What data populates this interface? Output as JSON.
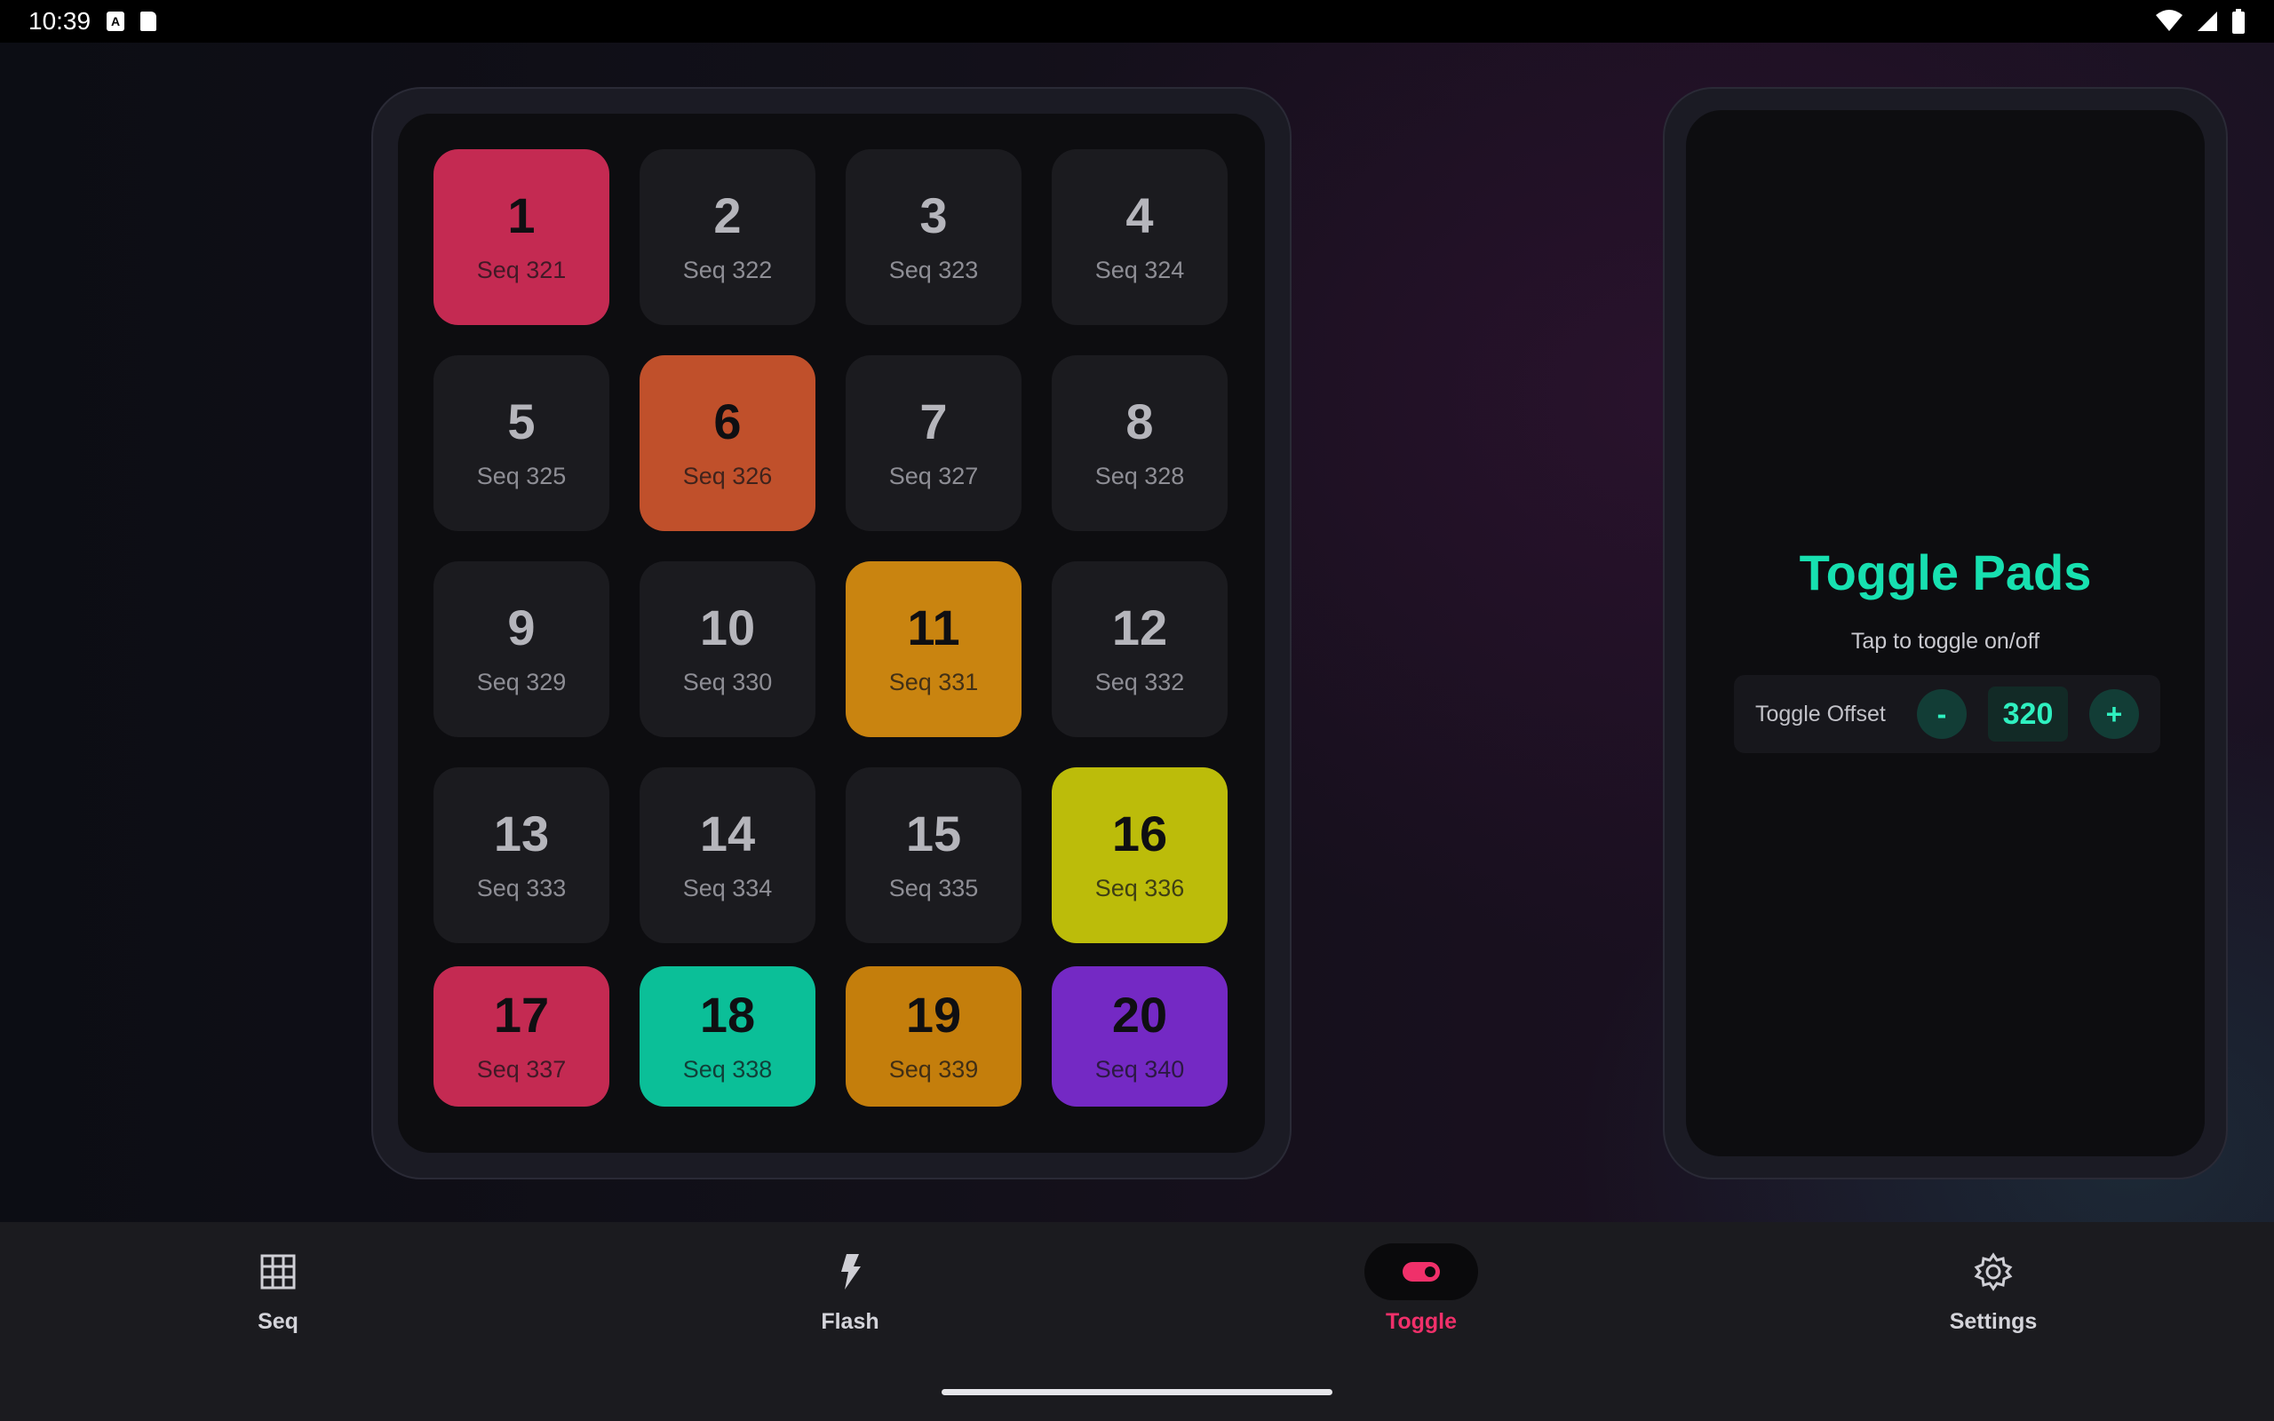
{
  "status_bar": {
    "time": "10:39"
  },
  "pads": [
    {
      "num": "1",
      "seq": "Seq 321",
      "on": true,
      "color": "#c42a52"
    },
    {
      "num": "2",
      "seq": "Seq 322",
      "on": false
    },
    {
      "num": "3",
      "seq": "Seq 323",
      "on": false
    },
    {
      "num": "4",
      "seq": "Seq 324",
      "on": false
    },
    {
      "num": "5",
      "seq": "Seq 325",
      "on": false
    },
    {
      "num": "6",
      "seq": "Seq 326",
      "on": true,
      "color": "#c0502b"
    },
    {
      "num": "7",
      "seq": "Seq 327",
      "on": false
    },
    {
      "num": "8",
      "seq": "Seq 328",
      "on": false
    },
    {
      "num": "9",
      "seq": "Seq 329",
      "on": false
    },
    {
      "num": "10",
      "seq": "Seq 330",
      "on": false
    },
    {
      "num": "11",
      "seq": "Seq 331",
      "on": true,
      "color": "#c98410"
    },
    {
      "num": "12",
      "seq": "Seq 332",
      "on": false
    },
    {
      "num": "13",
      "seq": "Seq 333",
      "on": false
    },
    {
      "num": "14",
      "seq": "Seq 334",
      "on": false
    },
    {
      "num": "15",
      "seq": "Seq 335",
      "on": false
    },
    {
      "num": "16",
      "seq": "Seq 336",
      "on": true,
      "color": "#bcbc0a"
    },
    {
      "num": "17",
      "seq": "Seq 337",
      "on": true,
      "color": "#c42a52"
    },
    {
      "num": "18",
      "seq": "Seq 338",
      "on": true,
      "color": "#0bbf98"
    },
    {
      "num": "19",
      "seq": "Seq 339",
      "on": true,
      "color": "#c47e0c"
    },
    {
      "num": "20",
      "seq": "Seq 340",
      "on": true,
      "color": "#7429c4"
    }
  ],
  "toggle_panel": {
    "title": "Toggle Pads",
    "subtitle": "Tap to toggle on/off",
    "offset_label": "Toggle Offset",
    "minus_label": "-",
    "offset_value": "320",
    "plus_label": "+"
  },
  "nav": [
    {
      "label": "Seq",
      "icon": "grid-icon",
      "active": false
    },
    {
      "label": "Flash",
      "icon": "flash-icon",
      "active": false
    },
    {
      "label": "Toggle",
      "icon": "toggle-icon",
      "active": true
    },
    {
      "label": "Settings",
      "icon": "gear-icon",
      "active": false
    }
  ],
  "colors": {
    "accent_teal": "#17e0b0",
    "accent_pink": "#f0306a"
  }
}
